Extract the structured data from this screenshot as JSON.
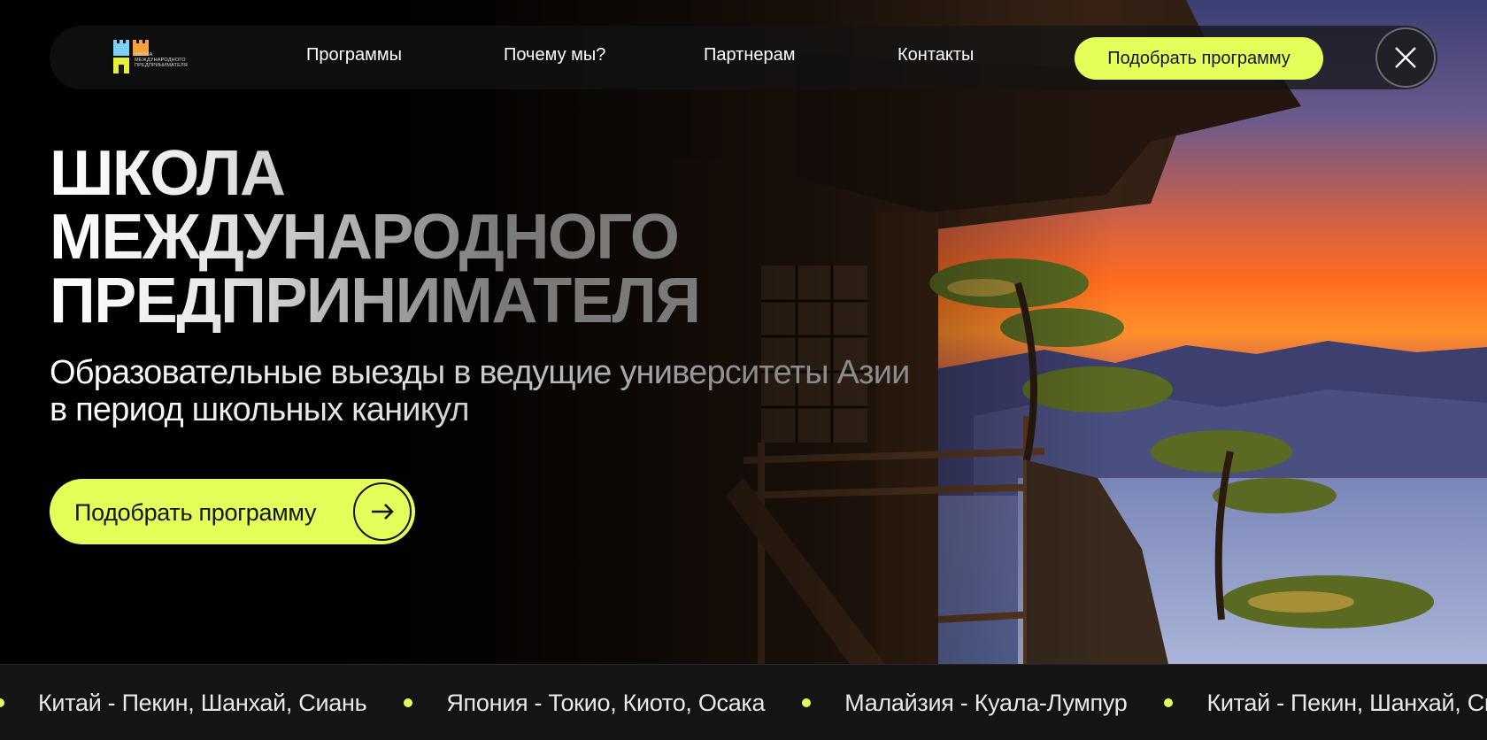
{
  "nav": {
    "logo_text": "ШКОЛА МЕЖДУНАРОДНОГО ПРЕДПРИНИМАТЕЛЯ",
    "links": [
      {
        "label": "Программы"
      },
      {
        "label": "Почему мы?"
      },
      {
        "label": "Партнерам"
      },
      {
        "label": "Контакты"
      }
    ],
    "cta_label": "Подобрать программу"
  },
  "hero": {
    "title_lines": [
      "ШКОЛА",
      "МЕЖДУНАРОДНОГО",
      "ПРЕДПРИНИМАТЕЛЯ"
    ],
    "subtitle_lines": [
      "Образовательные выезды в ведущие университеты Азии",
      "в период школьных каникул"
    ],
    "cta_label": "Подобрать программу"
  },
  "ticker": {
    "items": [
      "Китай - Пекин, Шанхай, Сиань",
      "Япония - Токио, Киото, Осака",
      "Малайзия - Куала-Лумпур",
      "Китай - Пекин, Шанхай, Сиань"
    ]
  },
  "colors": {
    "accent": "#e4fe5a",
    "background": "#000000",
    "ticker_bg": "#141414"
  },
  "icons": {
    "logo": "castle-logo-icon",
    "close": "close-icon",
    "arrow": "arrow-right-icon",
    "bullet": "dot-icon"
  }
}
